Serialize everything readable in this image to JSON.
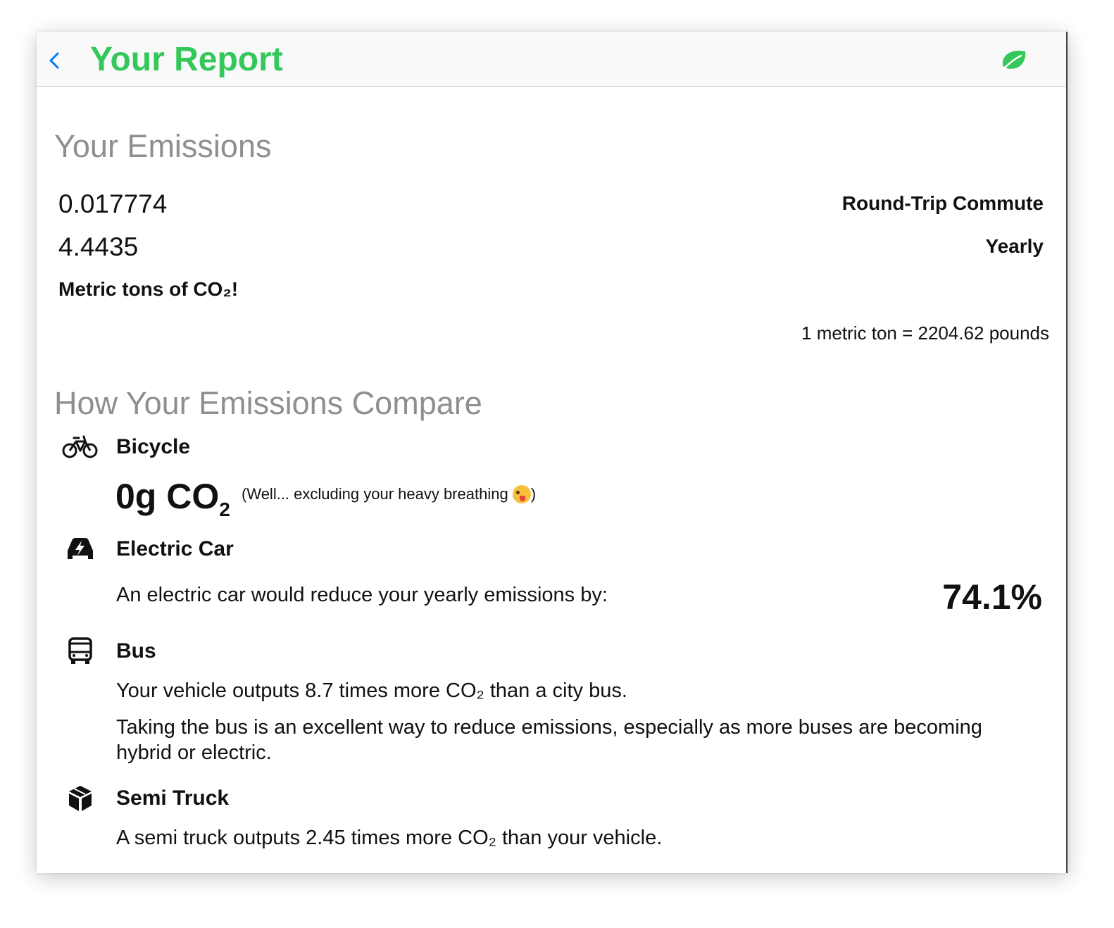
{
  "header": {
    "title": "Your Report",
    "back_icon": "chevron-left-icon",
    "right_icon": "leaf-icon",
    "accent_color": "#34c759"
  },
  "emissions": {
    "section_title": "Your Emissions",
    "commute_value": "0.017774",
    "commute_label": "Round-Trip Commute",
    "yearly_value": "4.4435",
    "yearly_label": "Yearly",
    "unit_text": "Metric tons of CO₂!",
    "conversion_note": "1 metric ton = 2204.62 pounds"
  },
  "compare": {
    "section_title": "How Your Emissions Compare",
    "bicycle": {
      "icon": "bicycle-icon",
      "title": "Bicycle",
      "headline_main": "0g CO",
      "headline_sub": "2",
      "note_prefix": "(Well... excluding your heavy breathing",
      "note_suffix": ")",
      "emoji": "winking-face-with-tongue"
    },
    "electric_car": {
      "icon": "electric-car-icon",
      "title": "Electric Car",
      "text": "An electric car would reduce your yearly emissions by:",
      "percent": "74.1%"
    },
    "bus": {
      "icon": "bus-icon",
      "title": "Bus",
      "text1": "Your vehicle outputs 8.7 times more CO₂ than a city bus.",
      "text2": "Taking the bus is an excellent way to reduce emissions, especially as more buses are becoming hybrid or electric."
    },
    "semi_truck": {
      "icon": "cube-box-icon",
      "title": "Semi Truck",
      "text": "A semi truck outputs 2.45 times more CO₂ than your vehicle."
    }
  }
}
